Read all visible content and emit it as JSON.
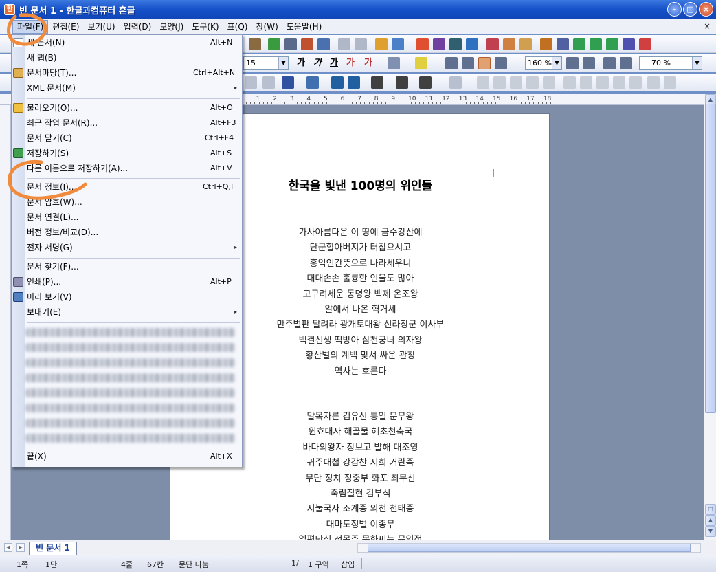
{
  "window": {
    "title": "빈 문서 1 - 한글과컴퓨터 흔글",
    "app_icon_glyph": "한",
    "min_glyph": "–",
    "max_glyph": "□",
    "close_glyph": "×"
  },
  "menubar": {
    "items": [
      "파일(F)",
      "편집(E)",
      "보기(U)",
      "입력(D)",
      "모양(J)",
      "도구(K)",
      "표(Q)",
      "창(W)",
      "도움말(H)"
    ],
    "close_glyph": "×"
  },
  "toolbar": {
    "font_size": "15",
    "char_spacing": "160 %",
    "zoom": "70 %",
    "style_glyphs": [
      "가",
      "가",
      "가",
      "가",
      "가"
    ]
  },
  "ruler": {
    "numbers": [
      "1",
      "2",
      "3",
      "4",
      "5",
      "6",
      "7",
      "8",
      "9",
      "10",
      "11",
      "12",
      "13",
      "14",
      "15",
      "16",
      "17",
      "18"
    ]
  },
  "document": {
    "title": "한국을 빛낸 100명의 위인들",
    "verse1": [
      "가사아름다운 이 땅에 금수강산에",
      "단군할아버지가 터잡으시고",
      "홍익인간뜻으로 나라세우니",
      "대대손손 훌륭한 인물도 많아",
      "고구려세운 동명왕 백제 온조왕",
      "알에서 나온 혁거세",
      "만주벌판 달려라 광개토대왕 신라장군 이사부",
      "백결선생 떡방아 삼천궁녀 의자왕",
      "황산벌의 계백 맞서 싸운 관창",
      "역사는 흐른다"
    ],
    "verse2": [
      "말목자른 김유신 통일 문무왕",
      "원효대사 해골물 혜초천축국",
      "바다의왕자 장보고 발해 대조영",
      "귀주대첩 강감찬 서희 거란족",
      "무단 정치 정중부 화포 최무선",
      "죽림칠현 김부식",
      "지눌국사 조계종 의천 천태종",
      "대마도정벌 이종무",
      "일편단심 정몽주 목화씨는 문익점"
    ]
  },
  "file_menu": {
    "items": [
      {
        "label": "새 문서(N)",
        "shortcut": "Alt+N"
      },
      {
        "label": "새 탭(B)",
        "shortcut": ""
      },
      {
        "label": "문서마당(T)...",
        "shortcut": "Ctrl+Alt+N"
      },
      {
        "label": "XML 문서(M)",
        "shortcut": ""
      },
      {
        "label": "불러오기(O)...",
        "shortcut": "Alt+O"
      },
      {
        "label": "최근 작업 문서(R)...",
        "shortcut": "Alt+F3"
      },
      {
        "label": "문서 닫기(C)",
        "shortcut": "Ctrl+F4"
      },
      {
        "label": "저장하기(S)",
        "shortcut": "Alt+S"
      },
      {
        "label": "다른 이름으로 저장하기(A)...",
        "shortcut": "Alt+V"
      },
      {
        "label": "문서 정보(I)...",
        "shortcut": "Ctrl+Q,I"
      },
      {
        "label": "문서 암호(W)...",
        "shortcut": ""
      },
      {
        "label": "문서 연결(L)...",
        "shortcut": ""
      },
      {
        "label": "버전 정보/비교(D)...",
        "shortcut": ""
      },
      {
        "label": "전자 서명(G)",
        "shortcut": ""
      },
      {
        "label": "문서 찾기(F)...",
        "shortcut": ""
      },
      {
        "label": "인쇄(P)...",
        "shortcut": "Alt+P"
      },
      {
        "label": "미리 보기(V)",
        "shortcut": ""
      },
      {
        "label": "보내기(E)",
        "shortcut": ""
      },
      {
        "label": "끝(X)",
        "shortcut": "Alt+X"
      }
    ],
    "submenu_glyph": "▸"
  },
  "tabs": {
    "doc_tab": "빈 문서 1"
  },
  "statusbar": {
    "page": "1쪽",
    "section": "1단",
    "line": "4줄",
    "column": "67칸",
    "break": "문단 나눔",
    "page_of": "1/",
    "zone": "1 구역",
    "mode": "삽입"
  },
  "colors": {
    "annotation": "#f08a3c",
    "titlebar": "#1550c8"
  }
}
